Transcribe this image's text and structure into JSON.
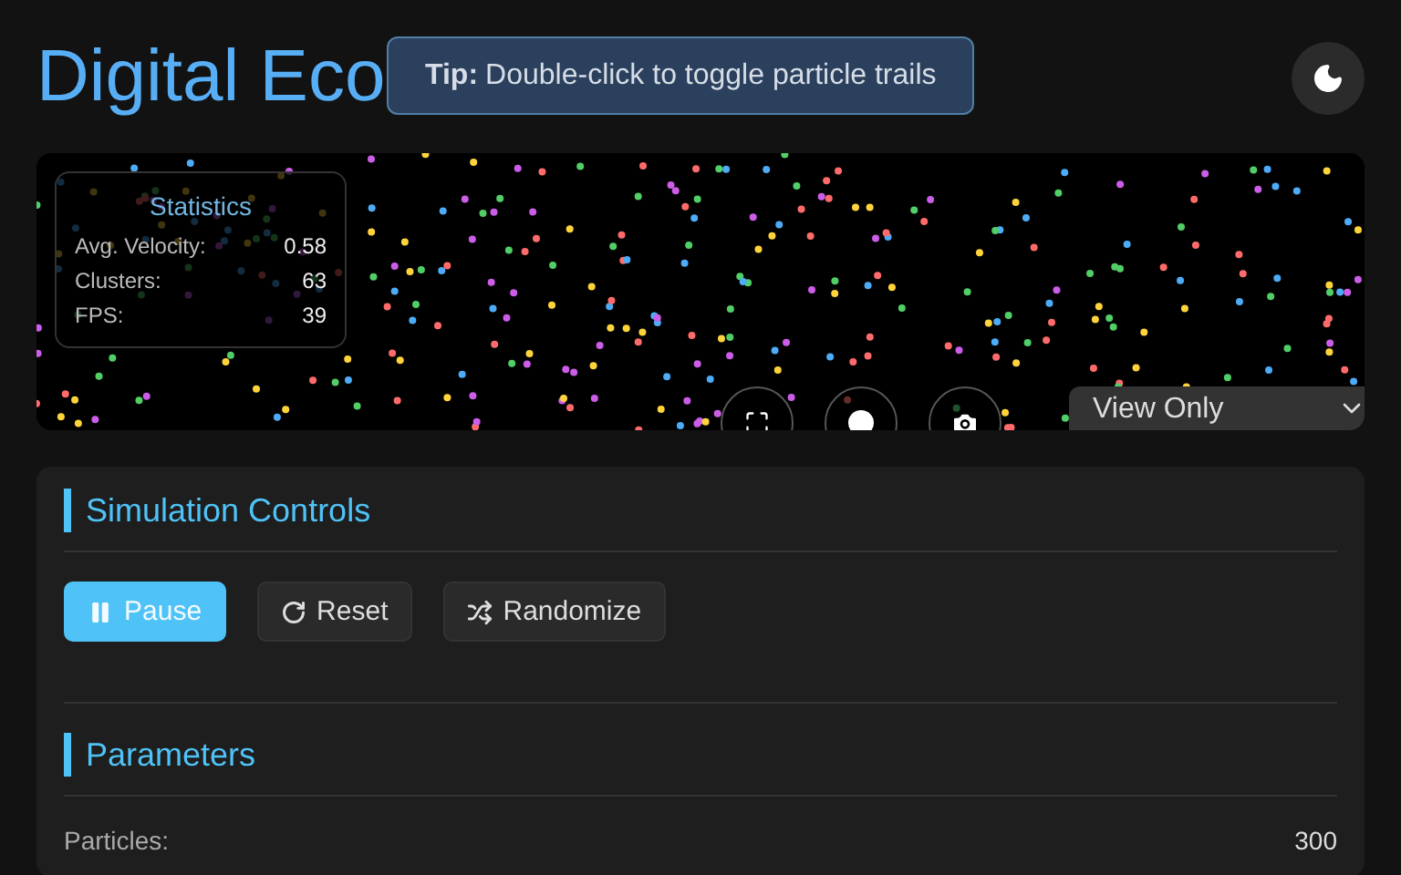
{
  "title": "Digital Eco",
  "tip": {
    "label": "Tip:",
    "text": "Double-click to toggle particle trails"
  },
  "stats": {
    "title": "Statistics",
    "rows": [
      {
        "label": "Avg. Velocity:",
        "value": "0.58"
      },
      {
        "label": "Clusters:",
        "value": "63"
      },
      {
        "label": "FPS:",
        "value": "39"
      }
    ]
  },
  "view_mode": {
    "value": "View Only"
  },
  "controls": {
    "heading": "Simulation Controls",
    "buttons": [
      {
        "kind": "pause",
        "label": "Pause",
        "selected": true
      },
      {
        "kind": "reset",
        "label": "Reset",
        "selected": false
      },
      {
        "kind": "randomize",
        "label": "Randomize",
        "selected": false
      }
    ]
  },
  "parameters": {
    "heading": "Parameters",
    "rows": [
      {
        "label": "Particles:",
        "value": "300"
      }
    ]
  }
}
